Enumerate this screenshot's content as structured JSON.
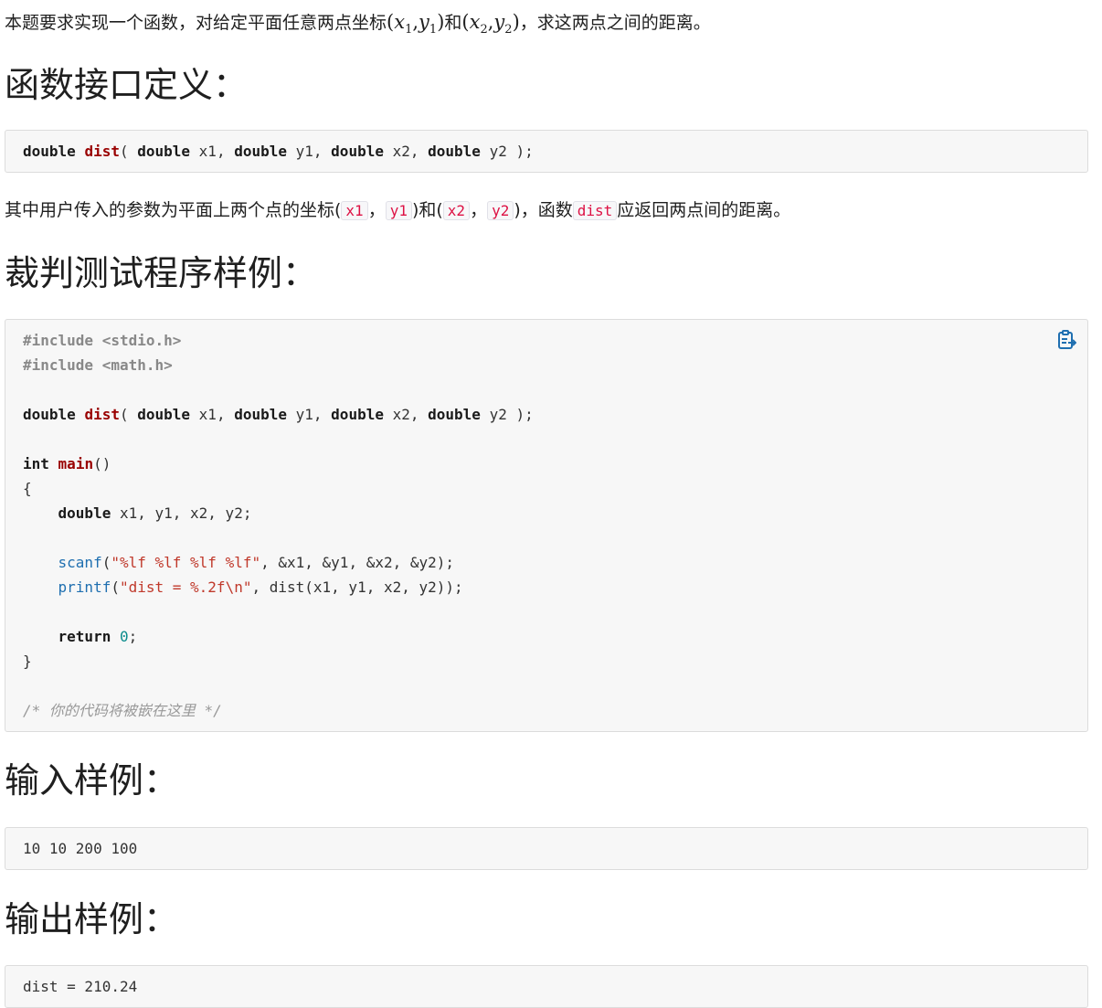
{
  "intro": {
    "text_a": "本题要求实现一个函数，对给定平面任意两点坐标",
    "p1_x": "x",
    "p1_x_sub": "1",
    "p1_y": "y",
    "p1_y_sub": "1",
    "and": "和",
    "p2_x": "x",
    "p2_x_sub": "2",
    "p2_y": "y",
    "p2_y_sub": "2",
    "text_b": "，求这两点之间的距离。"
  },
  "headings": {
    "interface": "函数接口定义：",
    "test_program": "裁判测试程序样例：",
    "input_sample": "输入样例：",
    "output_sample": "输出样例："
  },
  "interface_code": {
    "kw_double": "double",
    "fn_dist": "dist",
    "params": [
      "x1",
      "y1",
      "x2",
      "y2"
    ]
  },
  "explanation": {
    "text_a": "其中用户传入的参数为平面上两个点的坐标(",
    "x1": "x1",
    "sep1": "，",
    "y1": "y1",
    "mid": ")和(",
    "x2": "x2",
    "sep2": "，",
    "y2": "y2",
    "text_b": ")，函数",
    "dist": "dist",
    "text_c": "应返回两点间的距离。"
  },
  "test_program": {
    "include1": "#include <stdio.h>",
    "include2": "#include <math.h>",
    "main_kw": "int",
    "main_fn": "main",
    "main_paren": "()",
    "open_brace": "{",
    "close_brace": "}",
    "decl": " x1, y1, x2, y2;",
    "scanf_fn": "scanf",
    "scanf_str": "\"%lf %lf %lf %lf\"",
    "scanf_args": ", &x1, &y1, &x2, &y2);",
    "printf_fn": "printf",
    "printf_str": "\"dist = %.2f\\n\"",
    "printf_args": ", dist(x1, y1, x2, y2));",
    "return_kw": "return",
    "return_val": "0",
    "comment": "/* 你的代码将被嵌在这里 */"
  },
  "input_sample": "10 10 200 100",
  "output_sample": "dist = 210.24",
  "icons": {
    "copy": "clipboard-copy-icon"
  },
  "colors": {
    "keyword_fn": "#990000",
    "string": "#c0392b",
    "library": "#1f6fb0",
    "inline_code": "#dd1144"
  }
}
